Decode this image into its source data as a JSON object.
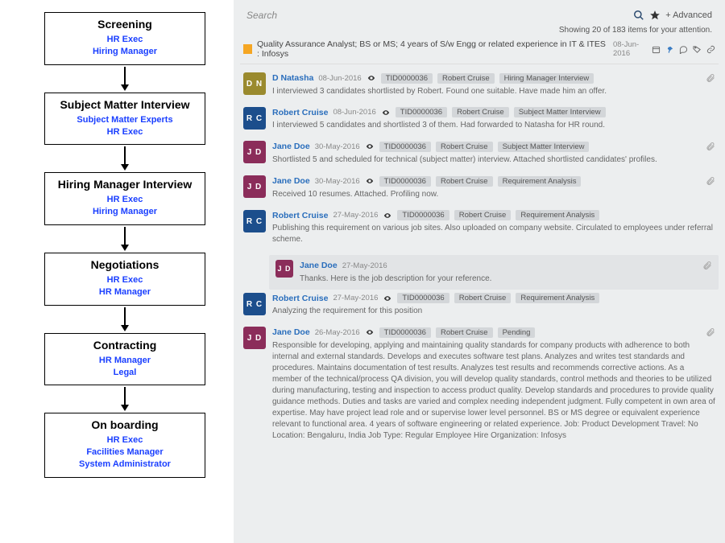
{
  "flow": [
    {
      "title": "Screening",
      "roles": [
        "HR Exec",
        "Hiring Manager"
      ]
    },
    {
      "title": "Subject Matter Interview",
      "roles": [
        "Subject Matter Experts",
        "HR Exec"
      ]
    },
    {
      "title": "Hiring Manager Interview",
      "roles": [
        "HR Exec",
        "Hiring Manager"
      ]
    },
    {
      "title": "Negotiations",
      "roles": [
        "HR Exec",
        "HR Manager"
      ]
    },
    {
      "title": "Contracting",
      "roles": [
        "HR Manager",
        "Legal"
      ]
    },
    {
      "title": "On boarding",
      "roles": [
        "HR Exec",
        "Facilities Manager",
        "System Administrator"
      ]
    }
  ],
  "search": {
    "placeholder": "Search",
    "advanced": "Advanced"
  },
  "status": {
    "summary": "Showing 20 of 183 items for your attention.",
    "date": "08-Jun-2016"
  },
  "ticket": {
    "title": "Quality Assurance Analyst; BS or MS; 4 years of S/w Engg or related experience in IT & ITES : Infosys"
  },
  "avatars": {
    "DN": {
      "initials": "D N",
      "bg": "#9a8a2e"
    },
    "RC": {
      "initials": "R C",
      "bg": "#1c4e8c"
    },
    "JD": {
      "initials": "J D",
      "bg": "#8b2d5a"
    }
  },
  "posts": [
    {
      "av": "DN",
      "author": "D Natasha",
      "date": "08-Jun-2016",
      "tags": [
        "TID0000036",
        "Robert Cruise",
        "Hiring Manager Interview"
      ],
      "text": "I interviewed 3 candidates shortlisted by Robert. Found one suitable. Have made him an offer.",
      "attach": true
    },
    {
      "av": "RC",
      "author": "Robert Cruise",
      "date": "08-Jun-2016",
      "tags": [
        "TID0000036",
        "Robert Cruise",
        "Subject Matter Interview"
      ],
      "text": "I interviewed 5 candidates and shortlisted 3 of them. Had forwarded to Natasha for HR round."
    },
    {
      "av": "JD",
      "author": "Jane Doe",
      "date": "30-May-2016",
      "tags": [
        "TID0000036",
        "Robert Cruise",
        "Subject Matter Interview"
      ],
      "text": "Shortlisted 5 and scheduled for technical (subject matter) interview. Attached shortlisted candidates' profiles.",
      "attach": true
    },
    {
      "av": "JD",
      "author": "Jane Doe",
      "date": "30-May-2016",
      "tags": [
        "TID0000036",
        "Robert Cruise",
        "Requirement Analysis"
      ],
      "text": "Received 10 resumes. Attached. Profiling now.",
      "attach": true
    },
    {
      "av": "RC",
      "author": "Robert Cruise",
      "date": "27-May-2016",
      "tags": [
        "TID0000036",
        "Robert Cruise",
        "Requirement Analysis"
      ],
      "text": "Publishing this requirement on various job sites. Also uploaded on company website. Circulated to employees under referral scheme.",
      "reply": {
        "av": "JD",
        "author": "Jane Doe",
        "date": "27-May-2016",
        "text": "Thanks. Here is the job description for your reference.",
        "attach": true
      }
    },
    {
      "av": "RC",
      "author": "Robert Cruise",
      "date": "27-May-2016",
      "tags": [
        "TID0000036",
        "Robert Cruise",
        "Requirement Analysis"
      ],
      "text": "Analyzing the requirement for this position"
    },
    {
      "av": "JD",
      "author": "Jane Doe",
      "date": "26-May-2016",
      "tags": [
        "TID0000036",
        "Robert Cruise",
        "Pending"
      ],
      "text": "Responsible for developing, applying and maintaining quality standards for company products with adherence to both internal and external standards. Develops and executes software test plans. Analyzes and writes test standards and procedures. Maintains documentation of test results. Analyzes test results and recommends corrective actions. As a member of the technical/process QA division, you will develop quality standards, control methods and theories to be utilized during manufacturing, testing and inspection to access product quality. Develop standards and procedures to provide quality guidance methods. Duties and tasks are varied and complex needing independent judgment. Fully competent in own area of expertise. May have project lead role and or supervise lower level personnel. BS or MS degree or equivalent experience relevant to functional area. 4 years of software engineering or related experience. Job: Product Development Travel: No Location: Bengaluru, India Job Type: Regular Employee Hire Organization: Infosys",
      "attach": true
    }
  ]
}
